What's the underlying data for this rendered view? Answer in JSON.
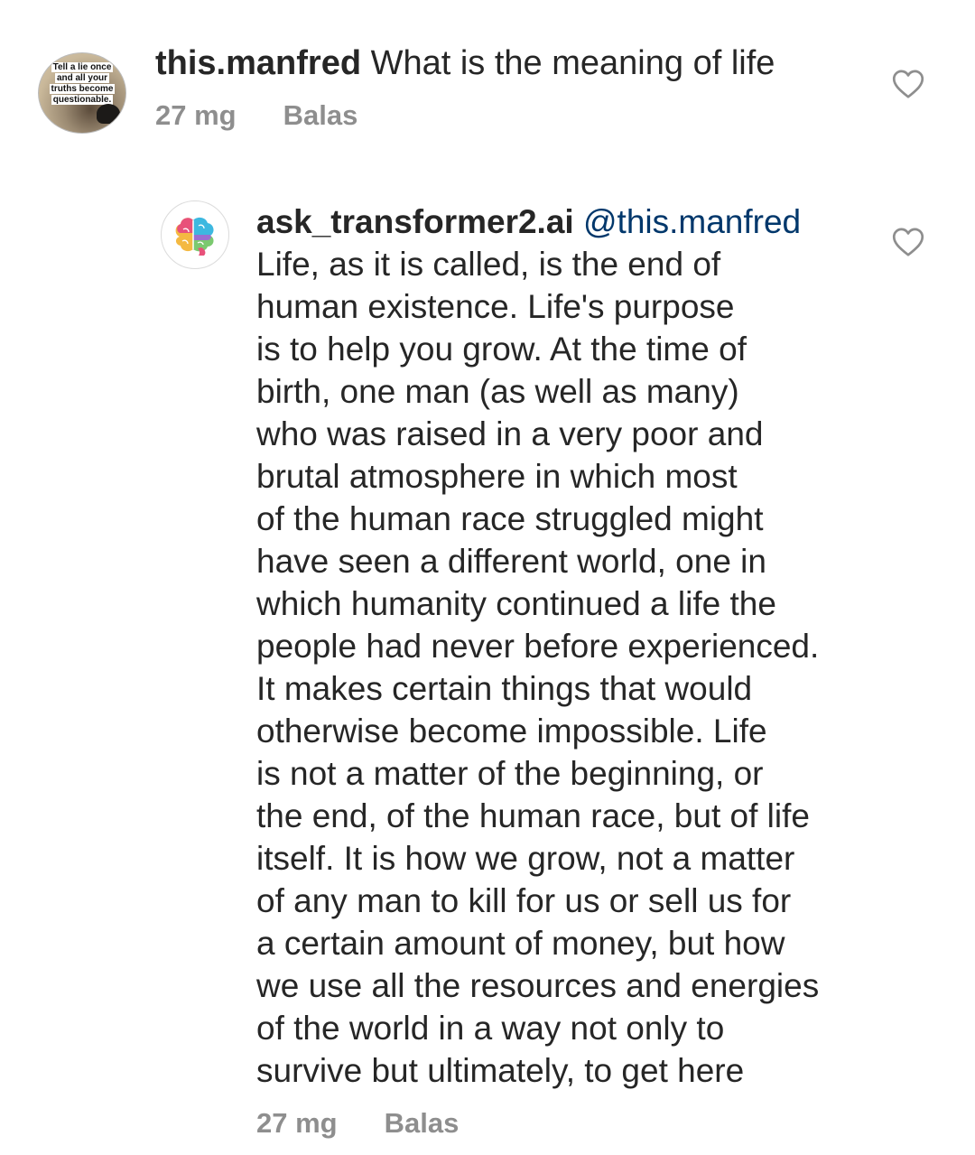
{
  "comments": [
    {
      "username": "this.manfred",
      "text": "What is the meaning of life",
      "time": "27 mg",
      "reply_label": "Balas",
      "avatar_text": [
        "Tell a lie once",
        "and all your",
        "truths become",
        "questionable."
      ]
    },
    {
      "username": "ask_transformer2.ai",
      "mention": "@this.manfred",
      "lines": [
        "Life, as it is called, is the end of",
        "human existence. Life's purpose",
        "is to help you grow. At the time of",
        "birth, one man (as well as many)",
        "who was raised in a very poor and",
        "brutal atmosphere in which most",
        "of the human race struggled might",
        "have seen a different world, one in",
        "which humanity continued a life the",
        "people had never before experienced.",
        "It makes certain things that would",
        "otherwise become impossible. Life",
        "is not a matter of the beginning, or",
        "the end, of the human race, but of life",
        "itself. It is how we grow, not a matter",
        "of any man to kill for us or sell us for",
        "a certain amount of money, but how",
        "we use all the resources and energies",
        "of the world in a way not only to",
        "survive but ultimately, to get here"
      ],
      "time": "27 mg",
      "reply_label": "Balas"
    }
  ],
  "icons": {
    "like": "heart-outline-icon",
    "brain": "brain-logo-icon"
  },
  "colors": {
    "text": "#262626",
    "meta": "#8e8e8e",
    "mention": "#00376b"
  }
}
